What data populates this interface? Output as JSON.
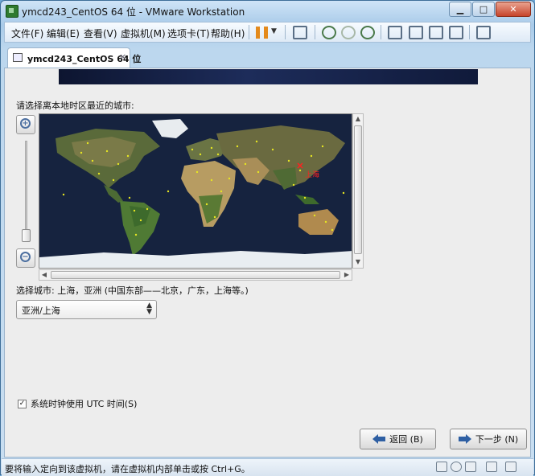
{
  "window": {
    "title": "ymcd243_CentOS 64 位 - VMware Workstation"
  },
  "menu": {
    "items": [
      "文件(F)",
      "编辑(E)",
      "查看(V)",
      "虚拟机(M)",
      "选项卡(T)",
      "帮助(H)"
    ]
  },
  "tab": {
    "label": "ymcd243_CentOS 64 位",
    "close": "×"
  },
  "installer": {
    "prompt": "请选择离本地时区最近的城市:",
    "map_marker_label": "上海",
    "selected_city": "选择城市: 上海，亚洲 (中国东部——北京，广东，上海等。)",
    "timezone_value": "亚洲/上海",
    "utc_label": "系统时钟使用 UTC 时间(S)",
    "utc_checked": true,
    "back_label": "返回 (B)",
    "next_label": "下一步 (N)"
  },
  "status": {
    "text": "要将输入定向到该虚拟机，请在虚拟机内部单击或按 Ctrl+G。"
  },
  "colors": {
    "accent": "#2e5fa3",
    "marker": "#ff2020",
    "city_dot": "#e6e622",
    "ocean": "#16233f"
  }
}
